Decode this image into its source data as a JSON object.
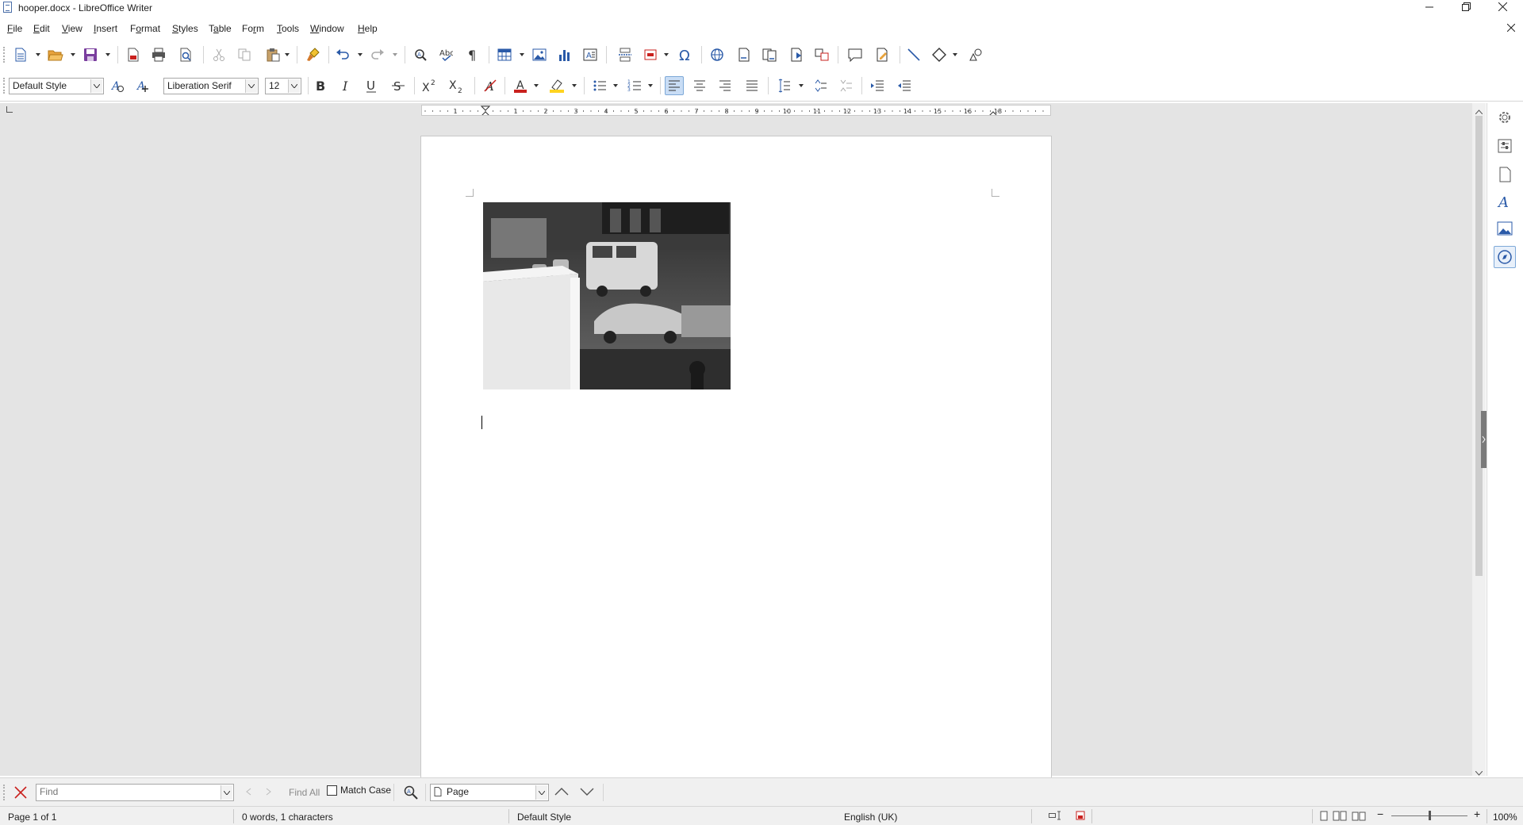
{
  "window": {
    "title": "hooper.docx - LibreOffice Writer"
  },
  "menu": [
    {
      "pre": "",
      "acc": "F",
      "post": "ile"
    },
    {
      "pre": "",
      "acc": "E",
      "post": "dit"
    },
    {
      "pre": "",
      "acc": "V",
      "post": "iew"
    },
    {
      "pre": "",
      "acc": "I",
      "post": "nsert"
    },
    {
      "pre": "F",
      "acc": "o",
      "post": "rmat"
    },
    {
      "pre": "",
      "acc": "S",
      "post": "tyles"
    },
    {
      "pre": "T",
      "acc": "a",
      "post": "ble"
    },
    {
      "pre": "Fo",
      "acc": "r",
      "post": "m"
    },
    {
      "pre": "",
      "acc": "T",
      "post": "ools"
    },
    {
      "pre": "",
      "acc": "W",
      "post": "indow"
    },
    {
      "pre": "",
      "acc": "H",
      "post": "elp"
    }
  ],
  "formatting": {
    "paragraph_style": "Default Style",
    "font_name": "Liberation Serif",
    "font_size": "12"
  },
  "ruler": {
    "labels": [
      "1",
      "1",
      "2",
      "3",
      "4",
      "5",
      "6",
      "7",
      "8",
      "9",
      "10",
      "11",
      "12",
      "13",
      "14",
      "15",
      "16",
      "18"
    ]
  },
  "find_bar": {
    "placeholder": "Find",
    "find_all": "Find All",
    "match_case": "Match Case",
    "search_type": "Page"
  },
  "status": {
    "page": "Page 1 of 1",
    "words": "0 words, 1 characters",
    "page_style": "Default Style",
    "language": "English (UK)",
    "zoom": "100%"
  },
  "colors": {
    "font_color": "#c9211e",
    "highlight_color": "#ffd320",
    "accent": "#2a5aa8"
  }
}
